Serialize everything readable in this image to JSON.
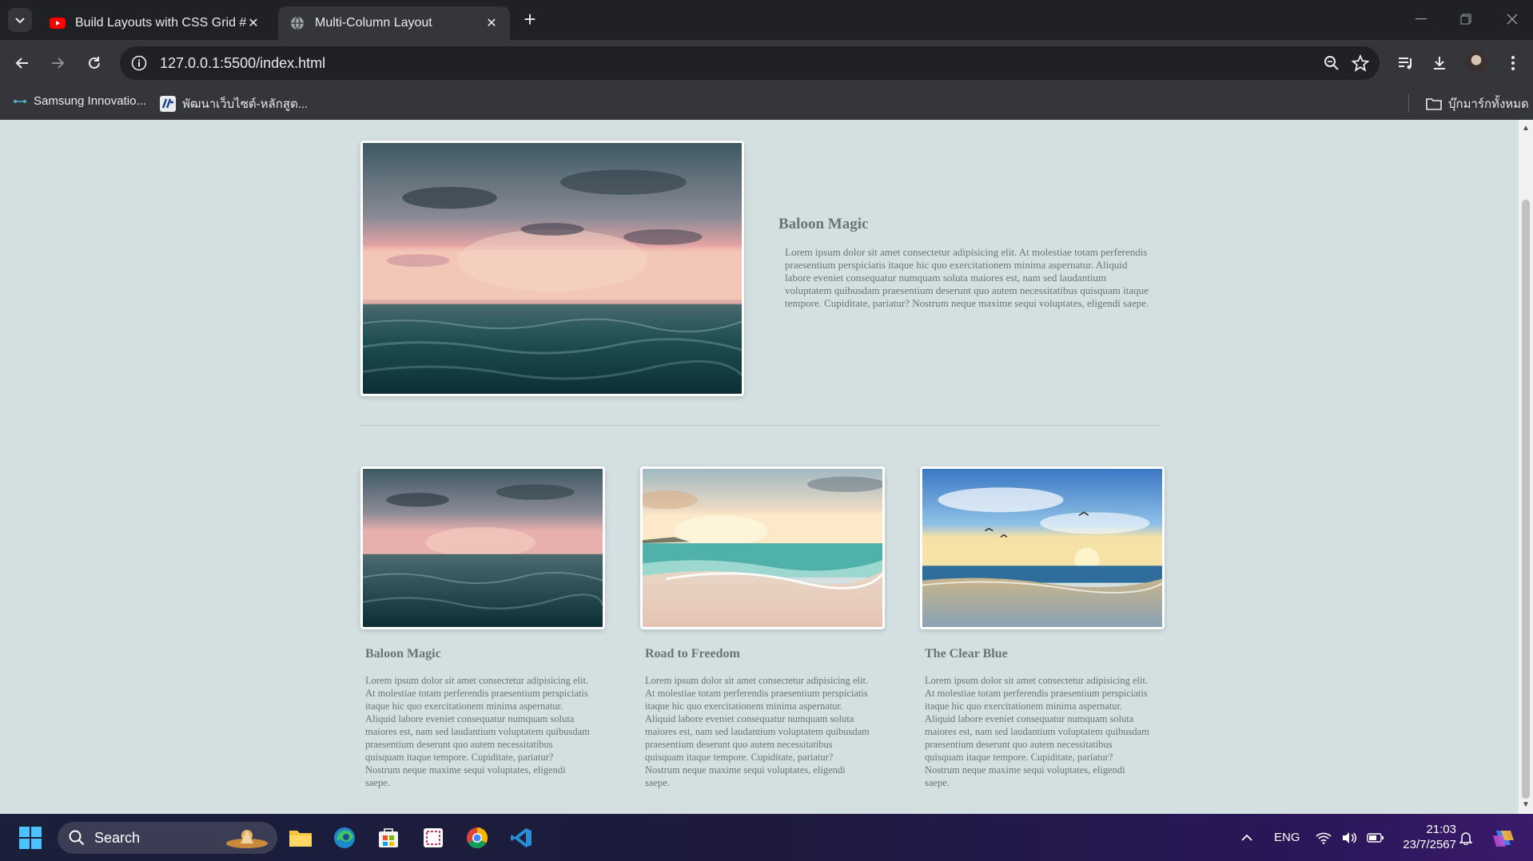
{
  "browser": {
    "tabs": [
      {
        "title": "Build Layouts with CSS Grid #3",
        "icon": "youtube-icon",
        "active": false
      },
      {
        "title": "Multi-Column Layout",
        "icon": "globe-icon",
        "active": true
      }
    ],
    "url": "127.0.0.1:5500/index.html",
    "bookmarks": [
      {
        "label": "Samsung Innovatio...",
        "icon": "samsung-icon"
      },
      {
        "label": "พัฒนาเว็บไซต์-หลักสูต...",
        "icon": "site-icon"
      }
    ],
    "all_bookmarks_label": "บุ๊กมาร์กทั้งหมด"
  },
  "page": {
    "hero": {
      "title": "Baloon Magic",
      "text": "Lorem ipsum dolor sit amet consectetur adipisicing elit. At molestiae totam perferendis praesentium perspiciatis itaque hic quo exercitationem minima aspernatur. Aliquid labore eveniet consequatur numquam soluta maiores est, nam sed laudantium voluptatem quibusdam praesentium deserunt quo autem necessitatibus quisquam itaque tempore. Cupiditate, pariatur? Nostrum neque maxime sequi voluptates, eligendi saepe."
    },
    "cards": [
      {
        "title": "Baloon Magic",
        "text": "Lorem ipsum dolor sit amet consectetur adipisicing elit. At molestiae totam perferendis praesentium perspiciatis itaque hic quo exercitationem minima aspernatur. Aliquid labore eveniet consequatur numquam soluta maiores est, nam sed laudantium voluptatem quibusdam praesentium deserunt quo autem necessitatibus quisquam itaque tempore. Cupiditate, pariatur? Nostrum neque maxime sequi voluptates, eligendi saepe."
      },
      {
        "title": "Road to Freedom",
        "text": "Lorem ipsum dolor sit amet consectetur adipisicing elit. At molestiae totam perferendis praesentium perspiciatis itaque hic quo exercitationem minima aspernatur. Aliquid labore eveniet consequatur numquam soluta maiores est, nam sed laudantium voluptatem quibusdam praesentium deserunt quo autem necessitatibus quisquam itaque tempore. Cupiditate, pariatur? Nostrum neque maxime sequi voluptates, eligendi saepe."
      },
      {
        "title": "The Clear Blue",
        "text": "Lorem ipsum dolor sit amet consectetur adipisicing elit. At molestiae totam perferendis praesentium perspiciatis itaque hic quo exercitationem minima aspernatur. Aliquid labore eveniet consequatur numquam soluta maiores est, nam sed laudantium voluptatem quibusdam praesentium deserunt quo autem necessitatibus quisquam itaque tempore. Cupiditate, pariatur? Nostrum neque maxime sequi voluptates, eligendi saepe."
      }
    ]
  },
  "taskbar": {
    "search_label": "Search",
    "language": "ENG",
    "time": "21:03",
    "date": "23/7/2567"
  },
  "colors": {
    "page_bg": "#d3dfe0",
    "text": "#6b7474",
    "chrome_dark": "#202124",
    "chrome_toolbar": "#35363a"
  }
}
